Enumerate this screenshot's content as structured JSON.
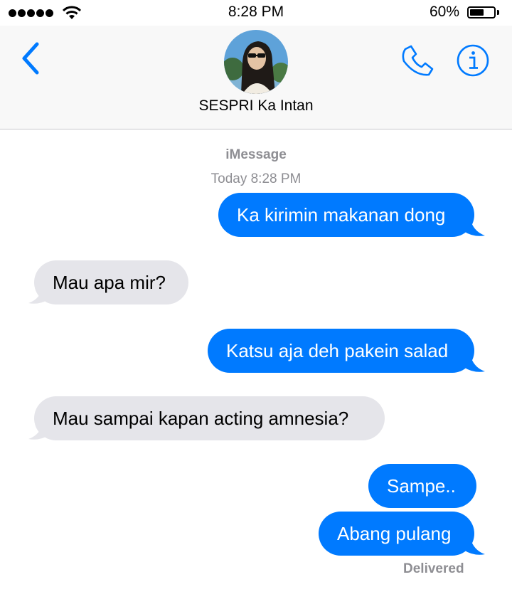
{
  "status_bar": {
    "time": "8:28 PM",
    "battery_percent": "60%",
    "battery_level": 0.6,
    "signal_icon": "cellular-signal-icon",
    "wifi_icon": "wifi-icon",
    "battery_icon": "battery-icon"
  },
  "header": {
    "contact_name": "SESPRI Ka Intan",
    "back_icon": "chevron-left-icon",
    "call_icon": "phone-icon",
    "info_icon": "info-icon",
    "accent_color": "#007aff"
  },
  "conversation": {
    "service": "iMessage",
    "timestamp": "Today 8:28 PM",
    "messages": [
      {
        "direction": "outgoing",
        "text": "Ka kirimin makanan dong"
      },
      {
        "direction": "incoming",
        "text": "Mau apa mir?"
      },
      {
        "direction": "outgoing",
        "text": "Katsu aja deh pakein salad"
      },
      {
        "direction": "incoming",
        "text": "Mau sampai kapan acting amnesia?"
      },
      {
        "direction": "outgoing",
        "text": "Sampe.."
      },
      {
        "direction": "outgoing",
        "text": "Abang pulang"
      }
    ],
    "delivery_status": "Delivered",
    "outgoing_color": "#007aff",
    "incoming_color": "#e5e5ea"
  }
}
